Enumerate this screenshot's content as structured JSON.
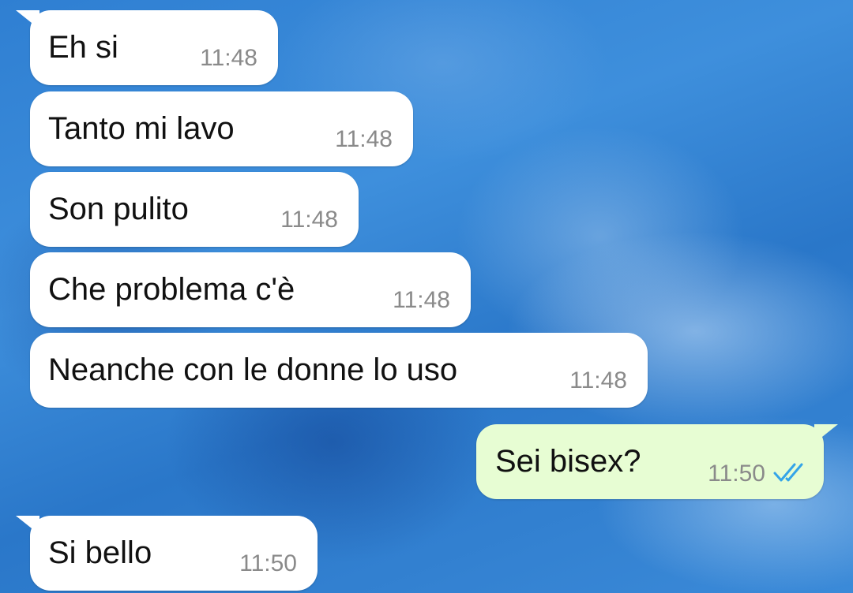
{
  "conversation": {
    "messages": [
      {
        "text": "Eh si",
        "time": "11:48",
        "direction": "incoming"
      },
      {
        "text": "Tanto mi lavo",
        "time": "11:48",
        "direction": "incoming"
      },
      {
        "text": "Son pulito",
        "time": "11:48",
        "direction": "incoming"
      },
      {
        "text": "Che problema c'è",
        "time": "11:48",
        "direction": "incoming"
      },
      {
        "text": "Neanche con le donne lo uso",
        "time": "11:48",
        "direction": "incoming"
      },
      {
        "text": "Sei bisex?",
        "time": "11:50",
        "direction": "outgoing",
        "status_icon": "double-check-read-icon"
      },
      {
        "text": "Si bello",
        "time": "11:50",
        "direction": "incoming"
      }
    ]
  },
  "colors": {
    "incoming_bubble": "#ffffff",
    "outgoing_bubble": "#e7fdd3",
    "read_ticks": "#34a4e8",
    "timestamp": "#8a8a8a"
  }
}
